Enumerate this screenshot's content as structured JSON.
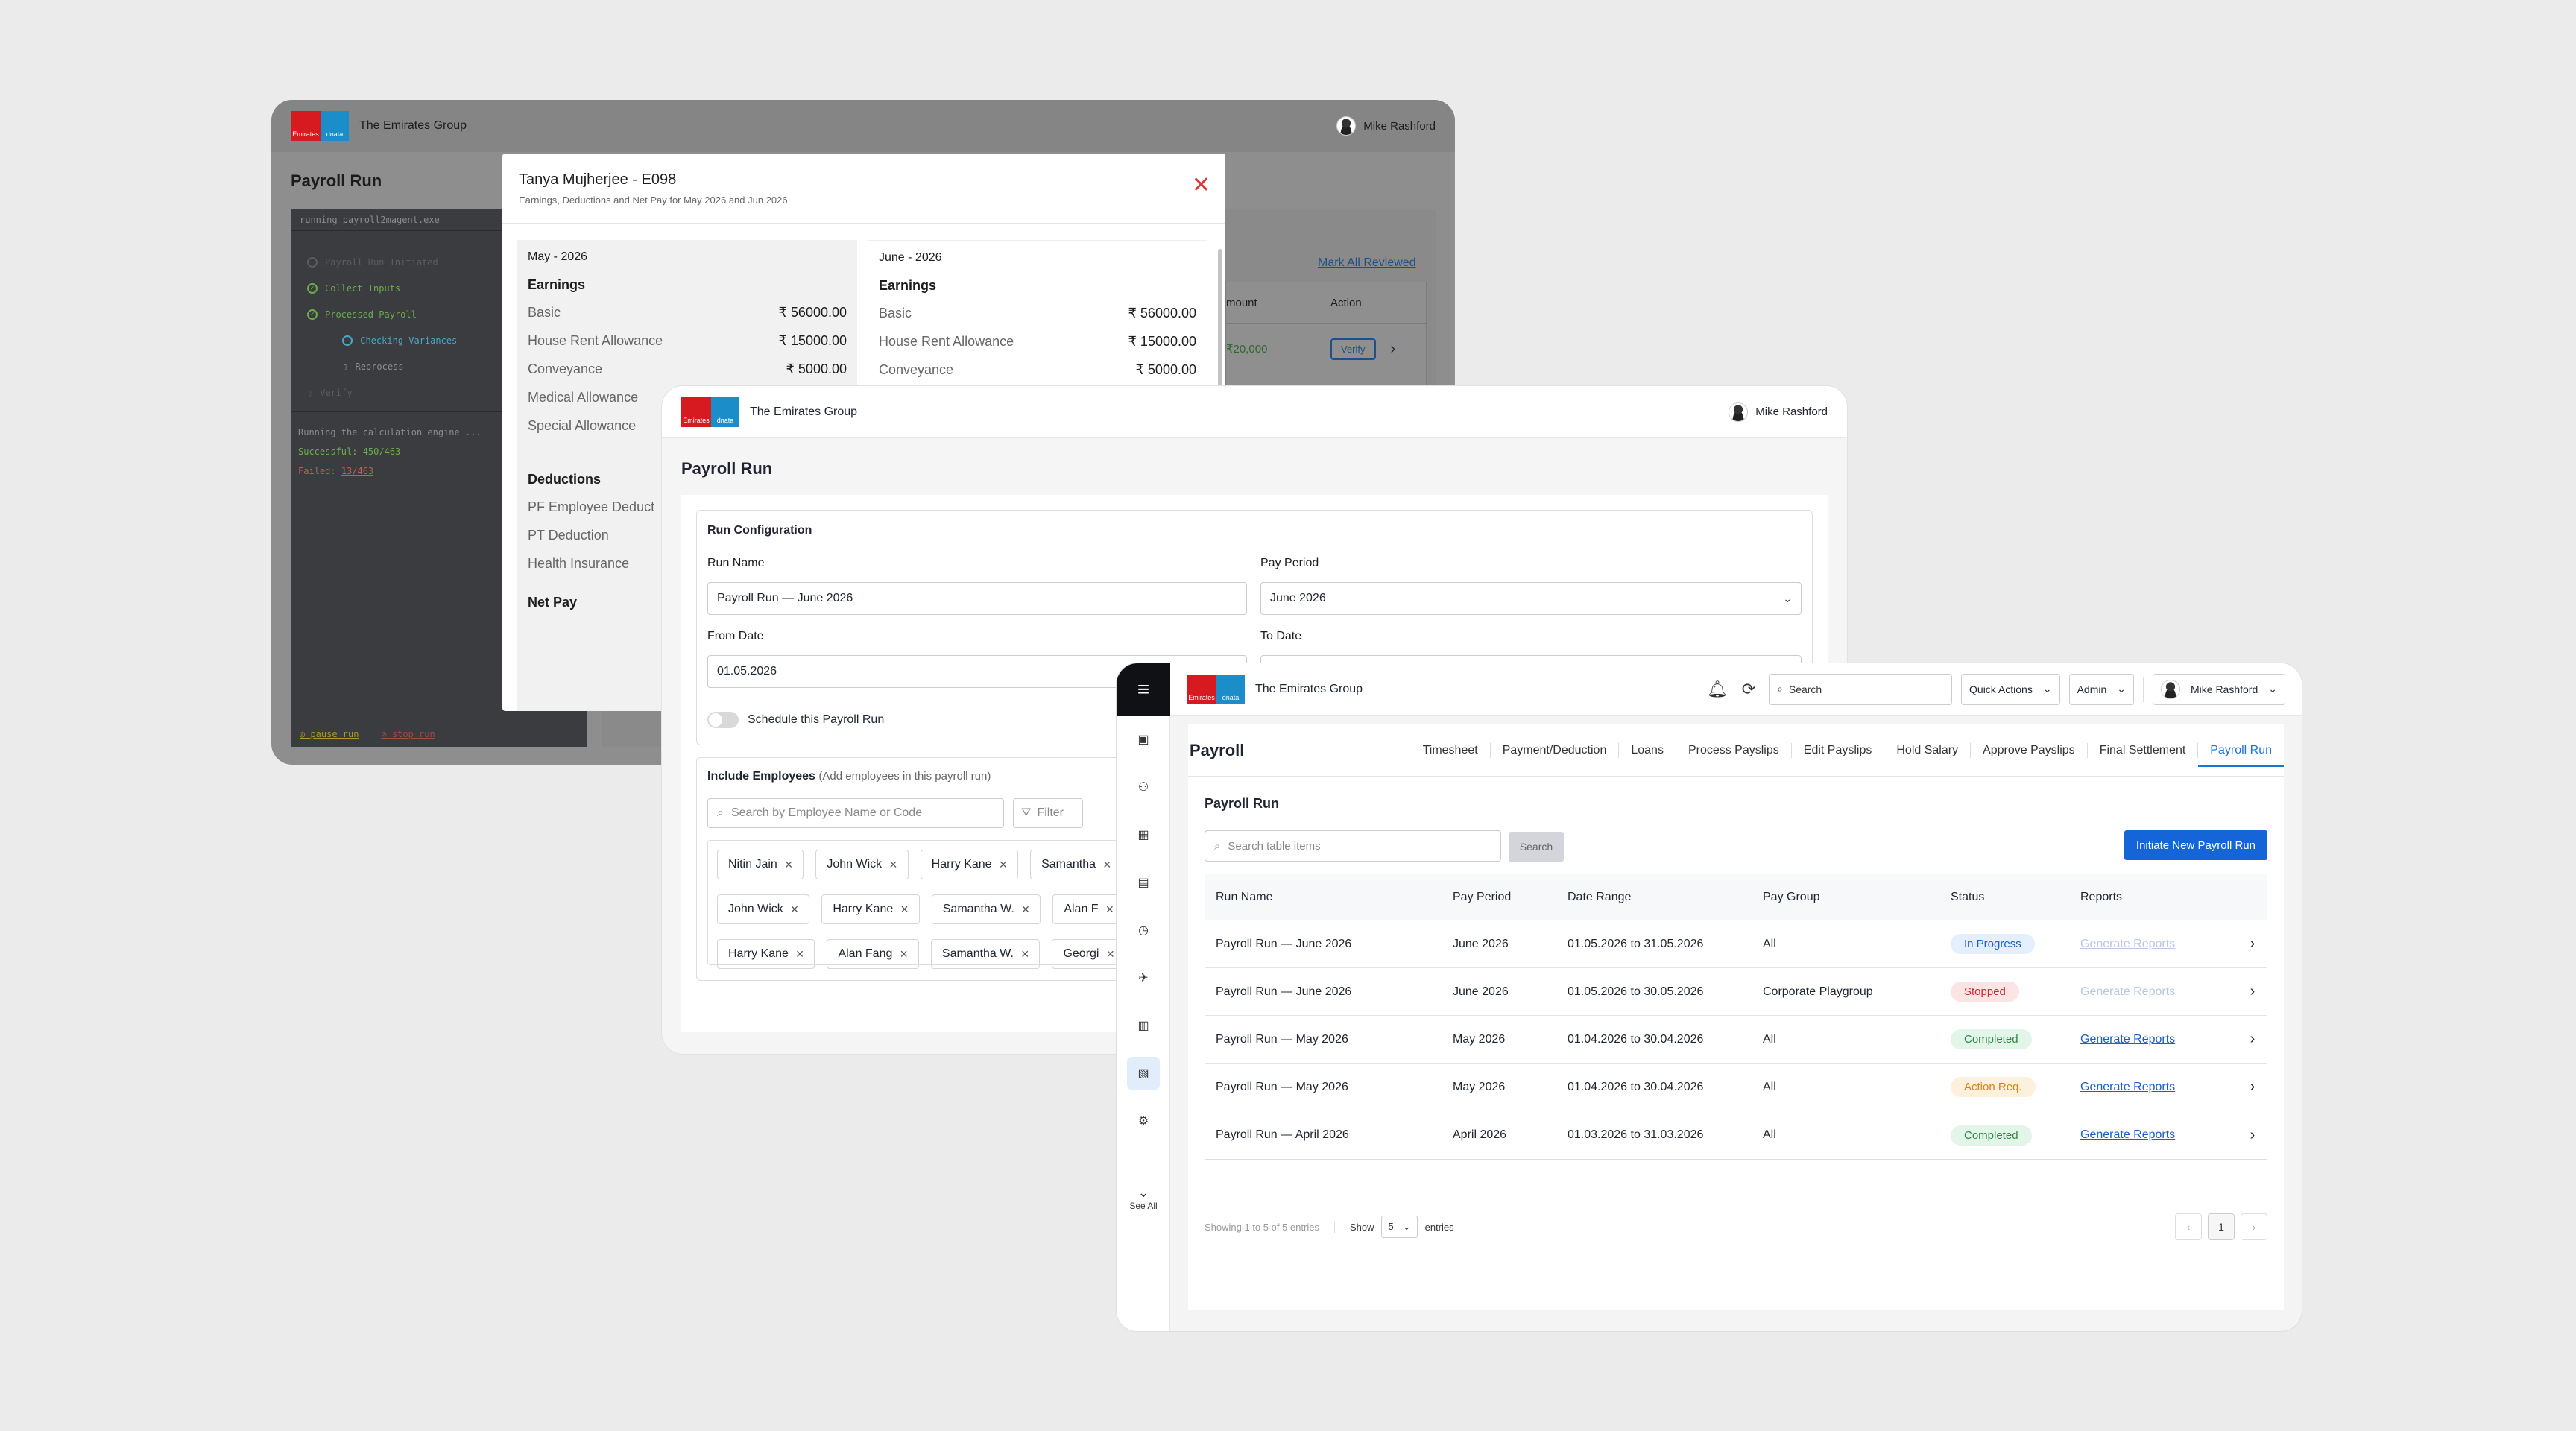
{
  "brand": {
    "logo_left": "Emirates",
    "logo_right": "dnata",
    "company": "The Emirates Group",
    "user": "Mike Rashford"
  },
  "colors": {
    "accent": "#1565d8",
    "success": "#2e9e4f",
    "danger": "#d63a3a",
    "warning": "#e69a1e"
  },
  "win1": {
    "page_title": "Payroll Run",
    "terminal": {
      "command": "running payroll2magent.exe",
      "steps": [
        {
          "label": "Payroll Run Initiated",
          "state": "done-dim"
        },
        {
          "label": "Collect Inputs",
          "state": "done"
        },
        {
          "label": "Processed Payroll",
          "state": "done"
        },
        {
          "label": "Checking Variances",
          "state": "active"
        },
        {
          "label": "Reprocess",
          "state": "pending"
        },
        {
          "label": "Verify",
          "state": "dim"
        }
      ],
      "log_line": "Running the calculation engine ...",
      "successful": "Successful: 450/463",
      "failed_label": "Failed:",
      "failed_value": "13/463",
      "pause": "pause run",
      "stop": "stop run"
    },
    "mark_all": "Mark All Reviewed",
    "table_head": {
      "amount": "mount",
      "action": "Action"
    },
    "row_amount": "₹20,000",
    "verify": "Verify"
  },
  "modal": {
    "employee": "Tanya Mujherjee - E098",
    "subtitle": "Earnings, Deductions and Net Pay for May 2026 and Jun 2026",
    "left": {
      "month": "May - 2026",
      "earnings_title": "Earnings",
      "earnings": [
        {
          "label": "Basic",
          "value": "₹ 56000.00"
        },
        {
          "label": "House Rent Allowance",
          "value": "₹ 15000.00"
        },
        {
          "label": "Conveyance",
          "value": "₹ 5000.00"
        },
        {
          "label": "Medical Allowance",
          "value": ""
        },
        {
          "label": "Special Allowance",
          "value": ""
        }
      ],
      "deductions_title": "Deductions",
      "deductions": [
        {
          "label": "PF Employee Deduct"
        },
        {
          "label": "PT Deduction"
        },
        {
          "label": "Health Insurance"
        }
      ],
      "net_pay": "Net Pay"
    },
    "right": {
      "month": "June - 2026",
      "earnings_title": "Earnings",
      "earnings": [
        {
          "label": "Basic",
          "value": "₹ 56000.00"
        },
        {
          "label": "House Rent Allowance",
          "value": "₹ 15000.00"
        },
        {
          "label": "Conveyance",
          "value": "₹ 5000.00"
        }
      ]
    }
  },
  "win2": {
    "page_title": "Payroll Run",
    "config": {
      "title": "Run Configuration",
      "run_name_label": "Run Name",
      "run_name_value": "Payroll Run — June 2026",
      "pay_period_label": "Pay Period",
      "pay_period_value": "June 2026",
      "from_label": "From Date",
      "from_value": "01.05.2026",
      "to_label": "To Date",
      "schedule": "Schedule this Payroll Run"
    },
    "employees": {
      "title": "Include Employees",
      "hint": "(Add employees in this payroll run)",
      "search_placeholder": "Search by Employee Name or Code",
      "filter": "Filter",
      "chips": [
        "Nitin Jain",
        "John Wick",
        "Harry Kane",
        "Samantha",
        "John Wick",
        "Harry Kane",
        "Samantha W.",
        "Alan F",
        "Harry Kane",
        "Alan Fang",
        "Samantha W.",
        "Georgi"
      ]
    }
  },
  "win3": {
    "search": "Search",
    "quick_actions": "Quick Actions",
    "role": "Admin",
    "see_all": "See All",
    "page_title": "Payroll",
    "tabs": [
      "Timesheet",
      "Payment/Deduction",
      "Loans",
      "Process Payslips",
      "Edit Payslips",
      "Hold Salary",
      "Approve Payslips",
      "Final Settlement",
      "Payroll Run"
    ],
    "section_title": "Payroll Run",
    "table_search_placeholder": "Search table items",
    "search_button": "Search",
    "initiate_button": "Initiate New Payroll Run",
    "columns": [
      "Run Name",
      "Pay Period",
      "Date Range",
      "Pay Group",
      "Status",
      "Reports"
    ],
    "rows": [
      {
        "name": "Payroll Run — June 2026",
        "period": "June 2026",
        "range": "01.05.2026 to 31.05.2026",
        "group": "All",
        "status": "In Progress",
        "status_bg": "#e3effc",
        "status_fg": "#1a5fc4",
        "report": "Generate Reports",
        "report_enabled": false
      },
      {
        "name": "Payroll Run — June 2026",
        "period": "June 2026",
        "range": "01.05.2026 to 30.05.2026",
        "group": "Corporate Playgroup",
        "status": "Stopped",
        "status_bg": "#fde4e4",
        "status_fg": "#c42b2b",
        "report": "Generate Reports",
        "report_enabled": false
      },
      {
        "name": "Payroll Run — May 2026",
        "period": "May 2026",
        "range": "01.04.2026 to 30.04.2026",
        "group": "All",
        "status": "Completed",
        "status_bg": "#e3f5e8",
        "status_fg": "#2e8a47",
        "report": "Generate Reports",
        "report_enabled": true
      },
      {
        "name": "Payroll Run — May 2026",
        "period": "May 2026",
        "range": "01.04.2026 to 30.04.2026",
        "group": "All",
        "status": "Action Req.",
        "status_bg": "#fdf0dc",
        "status_fg": "#d58410",
        "report": "Generate Reports",
        "report_enabled": true
      },
      {
        "name": "Payroll Run — April 2026",
        "period": "April 2026",
        "range": "01.03.2026 to 31.03.2026",
        "group": "All",
        "status": "Completed",
        "status_bg": "#e3f5e8",
        "status_fg": "#2e8a47",
        "report": "Generate Reports",
        "report_enabled": true
      }
    ],
    "showing": "Showing 1 to 5 of 5 entries",
    "show_label": "Show",
    "page_size": "5",
    "entries_label": "entries",
    "current_page": "1"
  }
}
